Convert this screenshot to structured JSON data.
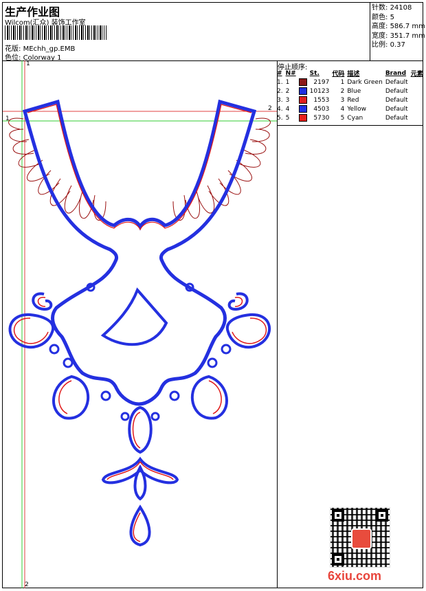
{
  "header": {
    "title": "生产作业图",
    "subtitle": "Wilcom(汇众) 装饰工作室",
    "design_label": "花版:",
    "design_value": "MEchh_gp.EMB",
    "colorway_label": "色位:",
    "colorway_value": "Colorway 1"
  },
  "stats": [
    {
      "label": "针数:",
      "value": "24108"
    },
    {
      "label": "颜色:",
      "value": "5"
    },
    {
      "label": "高度:",
      "value": "586.7 mm"
    },
    {
      "label": "宽度:",
      "value": "351.7 mm"
    },
    {
      "label": "比例:",
      "value": "0.37"
    }
  ],
  "stop_sequence": {
    "title": "停止顺序:",
    "headers": [
      "#",
      "N#",
      "St.",
      "代码",
      "描述",
      "Brand",
      "元素"
    ],
    "rows": [
      {
        "idx": "1.",
        "n": "1",
        "st": "2197",
        "code": "1",
        "desc": "Dark Green",
        "brand": "Default",
        "color": "#8b1a1a"
      },
      {
        "idx": "2.",
        "n": "2",
        "st": "10123",
        "code": "2",
        "desc": "Blue",
        "brand": "Default",
        "color": "#1f2fe0"
      },
      {
        "idx": "3.",
        "n": "3",
        "st": "1553",
        "code": "3",
        "desc": "Red",
        "brand": "Default",
        "color": "#e02020"
      },
      {
        "idx": "4.",
        "n": "4",
        "st": "4503",
        "code": "4",
        "desc": "Yellow",
        "brand": "Default",
        "color": "#2030e8"
      },
      {
        "idx": "5.",
        "n": "5",
        "st": "5730",
        "code": "5",
        "desc": "Cyan",
        "brand": "Default",
        "color": "#e8201c"
      }
    ]
  },
  "axis_labels": {
    "v1": "1",
    "v2": "2",
    "h1": "1",
    "h2": "2"
  },
  "watermark": "6xiu.com",
  "colors": {
    "blue": "#2430e0",
    "red": "#e01818",
    "darkred": "#9a1010",
    "guide_green": "#33cc33",
    "guide_red": "#e04040"
  }
}
